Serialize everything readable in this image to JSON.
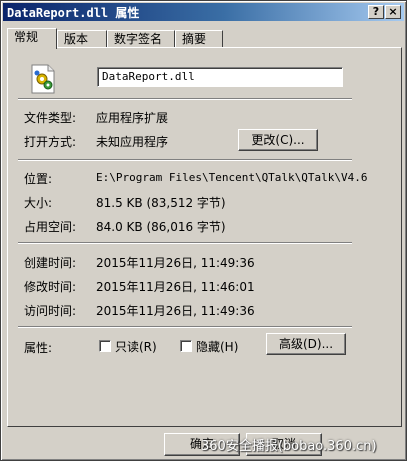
{
  "window": {
    "title": "DataReport.dll 属性",
    "help_label": "?",
    "close_label": "×"
  },
  "tabs": [
    {
      "label": "常规"
    },
    {
      "label": "版本"
    },
    {
      "label": "数字签名"
    },
    {
      "label": "摘要"
    }
  ],
  "general": {
    "file_name": "DataReport.dll",
    "type_label": "文件类型:",
    "type_value": "应用程序扩展",
    "opens_label": "打开方式:",
    "opens_value": "未知应用程序",
    "change_button": "更改(C)...",
    "location_label": "位置:",
    "location_value": "E:\\Program Files\\Tencent\\QTalk\\QTalk\\V4.6",
    "size_label": "大小:",
    "size_value": "81.5 KB (83,512 字节)",
    "disk_label": "占用空间:",
    "disk_value": "84.0 KB (86,016 字节)",
    "created_label": "创建时间:",
    "created_value": "2015年11月26日, 11:49:36",
    "modified_label": "修改时间:",
    "modified_value": "2015年11月26日, 11:46:01",
    "accessed_label": "访问时间:",
    "accessed_value": "2015年11月26日, 11:49:36",
    "attributes_label": "属性:",
    "readonly_label": "只读(R)",
    "hidden_label": "隐藏(H)",
    "advanced_button": "高级(D)..."
  },
  "footer": {
    "ok_button": "确定",
    "cancel_button": "取消",
    "watermark": "360安全播报(bobao.360.cn)"
  }
}
